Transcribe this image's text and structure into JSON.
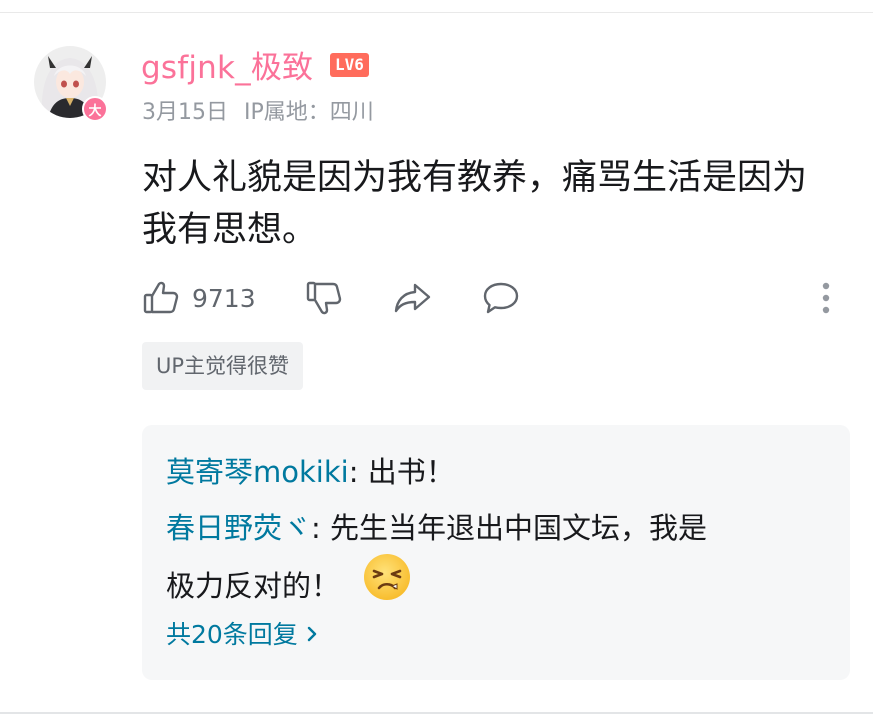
{
  "comment": {
    "username": "gsfjnk_极致",
    "level_badge": "LV6",
    "avatar_badge": "大",
    "date": "3月15日",
    "ip_location": "IP属地：四川",
    "text_line1": "对人礼貌是因为我有教养，痛骂生活是因为",
    "text_line2": "我有思想。",
    "likes": "9713",
    "up_tag": "UP主觉得很赞"
  },
  "replies": {
    "items": [
      {
        "name": "莫寄琴mokiki",
        "sep": ": ",
        "text": "出书！"
      },
      {
        "name": "春日野荧ヾ",
        "sep": ": ",
        "text": "先生当年退出中国文坛，我是"
      },
      {
        "text_cont": "极力反对的！"
      }
    ],
    "more_label": "共20条回复"
  },
  "colors": {
    "username": "#fb7299",
    "level_badge": "#ff6c5c",
    "reply_name": "#00799f",
    "meta": "#9499a0",
    "reply_bg": "#f6f7f8"
  },
  "icons": [
    "thumbs-up-icon",
    "thumbs-down-icon",
    "share-icon",
    "comment-icon",
    "more-vertical-icon",
    "annoyed-emoji",
    "chevron-right-icon"
  ]
}
